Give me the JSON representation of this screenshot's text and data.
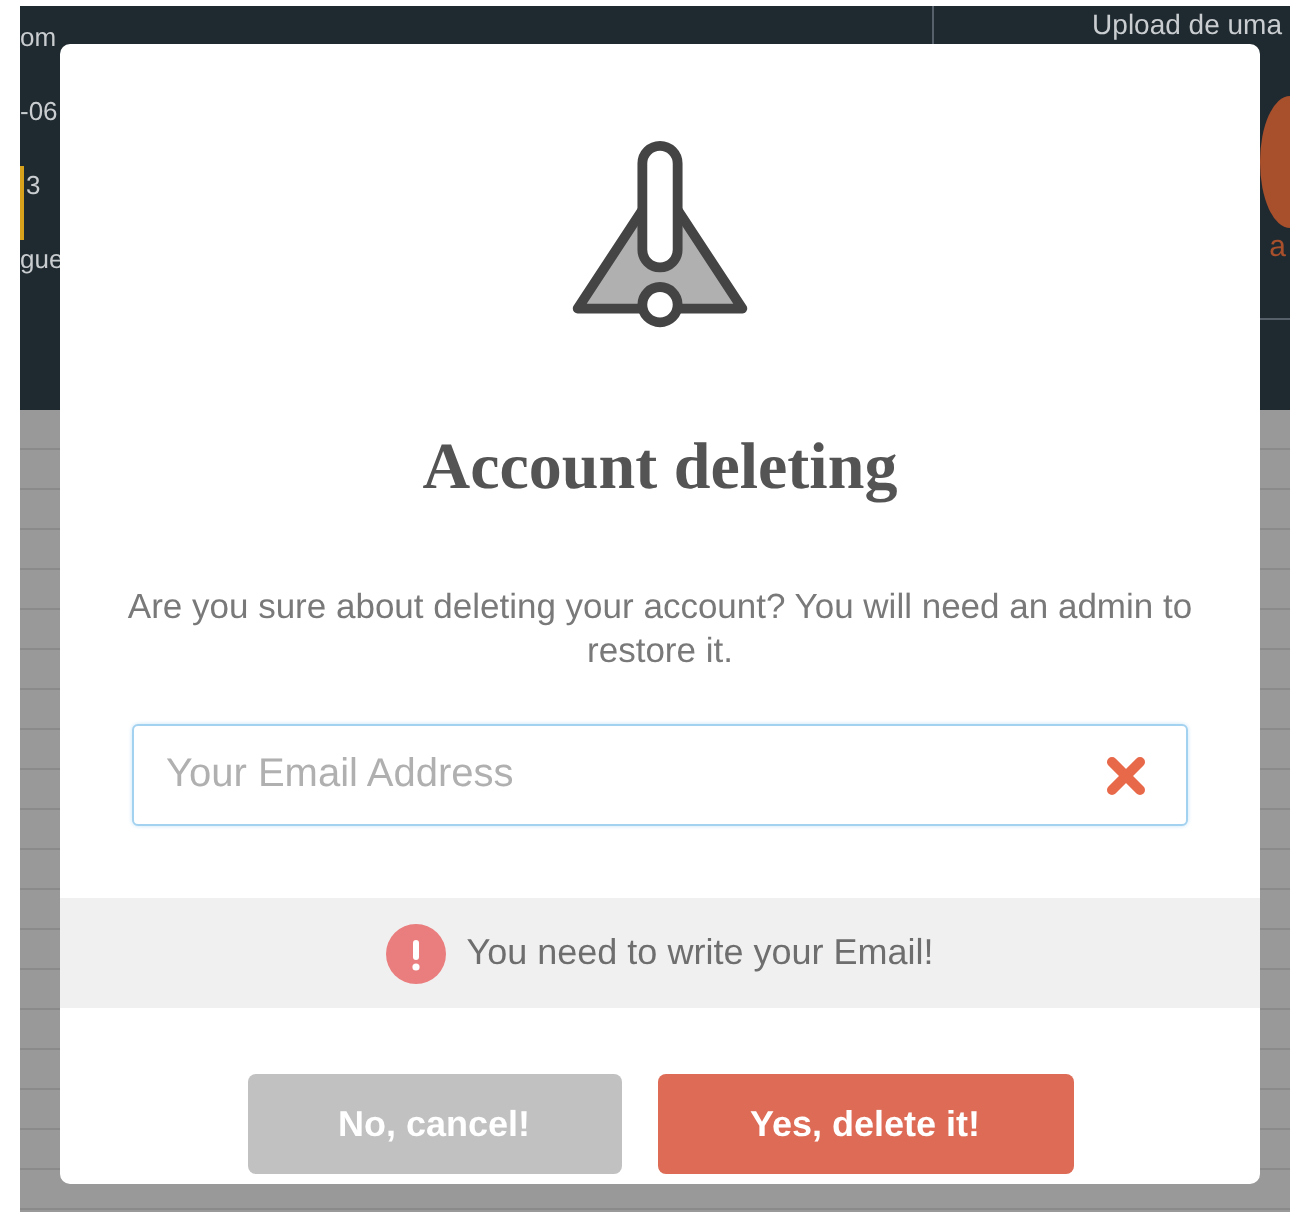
{
  "background": {
    "left_fragments": [
      {
        "text": "om",
        "marked": false
      },
      {
        "text": "-06",
        "marked": false
      },
      {
        "text": "3",
        "marked": true
      },
      {
        "text": "gue",
        "marked": false
      }
    ],
    "upload_label": "Upload de uma",
    "upload_caption": "a"
  },
  "dialog": {
    "title": "Account deleting",
    "message": "Are you sure about deleting your account? You will need an admin to restore it.",
    "email_field": {
      "placeholder": "Your Email Address"
    },
    "error": "You need to write your Email!",
    "buttons": [
      {
        "label": "No, cancel!",
        "kind": "cancel"
      },
      {
        "label": "Yes, delete it!",
        "kind": "confirm"
      }
    ]
  }
}
